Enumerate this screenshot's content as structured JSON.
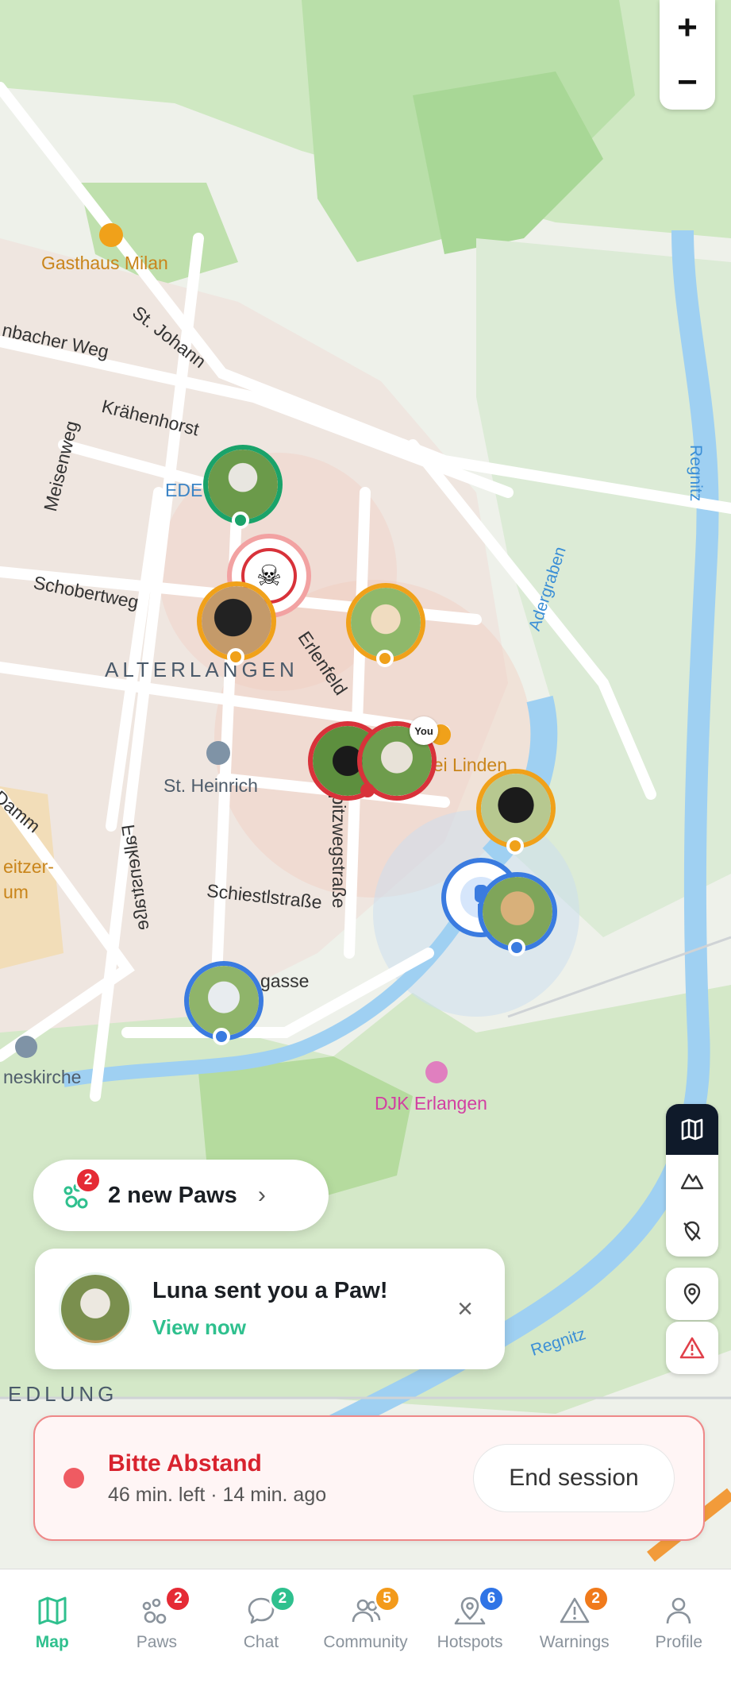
{
  "map": {
    "labels": {
      "gasthaus": "Gasthaus Milan",
      "st_johann": "St. Johann",
      "bacher_weg": "nbacher Weg",
      "kraehenhorst": "Krähenhorst",
      "meisenweg": "Meisenweg",
      "edeka": "EDE     mann",
      "schobertweg": "Schobertweg",
      "alterlangen": "ALTERLANGEN",
      "erlenfeld": "Erlenfeld",
      "falkenstrasse": "Falkenstraße",
      "st_heinrich": "St. Heinrich",
      "drei_linden": "rei Linden",
      "damm": "Damm",
      "weitzer": "eitzer-",
      "um": "um",
      "spitzwegstrasse": "Spitzwegstraße",
      "schiestlstrasse": "Schiestlstraße",
      "gasse": "gasse",
      "kirche": "neskirche",
      "djk": "DJK Erlangen",
      "siedlung": "EDLUNG",
      "regnitz_top": "Regnitz",
      "adergraben": "Adergraben",
      "regnitz_bottom": "Regnitz"
    },
    "you_label": "You",
    "zoom_in": "+",
    "zoom_out": "−",
    "colors": {
      "green_ring": "#1aa36a",
      "orange_ring": "#f0a11a",
      "red_ring": "#d8323a",
      "blue_ring": "#3a7be0"
    }
  },
  "paws_pill": {
    "badge": "2",
    "text": "2 new Paws",
    "chevron": "›"
  },
  "notification": {
    "title": "Luna sent you a Paw!",
    "link": "View now",
    "close": "×"
  },
  "session": {
    "title": "Bitte Abstand",
    "subtitle": "46 min. left · 14 min. ago",
    "end_button": "End session"
  },
  "nav": {
    "items": [
      {
        "label": "Map",
        "badge": "",
        "icon": "map-icon"
      },
      {
        "label": "Paws",
        "badge": "2",
        "icon": "paws-icon",
        "badge_color": "#e52b35"
      },
      {
        "label": "Chat",
        "badge": "2",
        "icon": "chat-icon",
        "badge_color": "#2fc08e"
      },
      {
        "label": "Community",
        "badge": "5",
        "icon": "community-icon",
        "badge_color": "#f39a1b"
      },
      {
        "label": "Hotspots",
        "badge": "6",
        "icon": "hotspots-icon",
        "badge_color": "#2f74e6"
      },
      {
        "label": "Warnings",
        "badge": "2",
        "icon": "warnings-icon",
        "badge_color": "#f07a1b"
      },
      {
        "label": "Profile",
        "badge": "",
        "icon": "profile-icon"
      }
    ]
  }
}
